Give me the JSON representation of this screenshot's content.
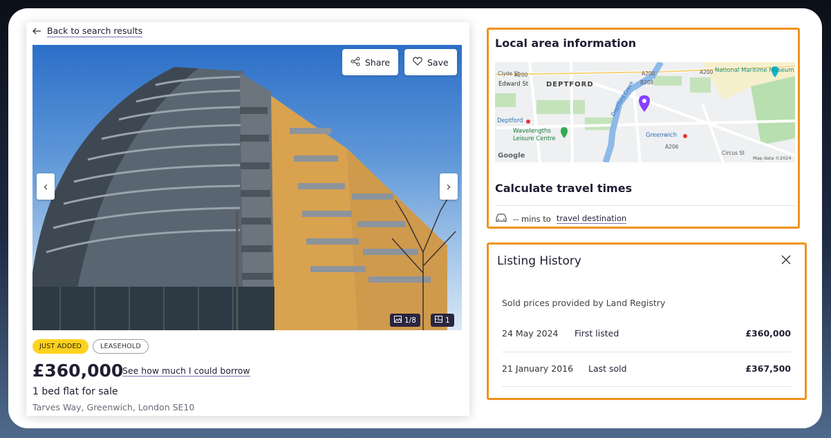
{
  "listing": {
    "back_label": "Back to search results",
    "share_label": "Share",
    "save_label": "Save",
    "photo_counter": "1/8",
    "floorplan_counter": "1",
    "tags": [
      "JUST ADDED",
      "LEASEHOLD"
    ],
    "price": "£360,000",
    "borrow_link": "See how much I could borrow",
    "property_type": "1 bed flat for sale",
    "address": "Tarves Way, Greenwich, London SE10"
  },
  "local_area": {
    "title": "Local area information",
    "map_labels": {
      "deptford": "DEPTFORD",
      "maritime": "National Maritime Museum",
      "deptford_station": "Deptford",
      "greenwich_station": "Greenwich",
      "leisure": "Wavelengths Leisure Centre",
      "edward_st": "Edward St",
      "clyde_st": "Clyde St",
      "a200_1": "A200",
      "a200_2": "A200",
      "a200_3": "A200",
      "a206": "A206",
      "b208": "B208",
      "creek": "Deptford Creek",
      "circus_st": "Circus St",
      "copyright": "Map data ©2024",
      "google": "Google"
    },
    "travel_title": "Calculate travel times",
    "travel_prefix": "-- mins to",
    "travel_destination": "travel destination"
  },
  "history": {
    "title": "Listing History",
    "source_note": "Sold prices provided by Land Registry",
    "rows": [
      {
        "date": "24 May 2024",
        "event": "First listed",
        "amount": "£360,000"
      },
      {
        "date": "21 January 2016",
        "event": "Last sold",
        "amount": "£367,500"
      }
    ]
  },
  "colors": {
    "highlight_border": "#f0921a",
    "tag_just_added": "#ffd21f",
    "map_pin": "#8a3ffc",
    "link_underline": "#7a74b8"
  }
}
